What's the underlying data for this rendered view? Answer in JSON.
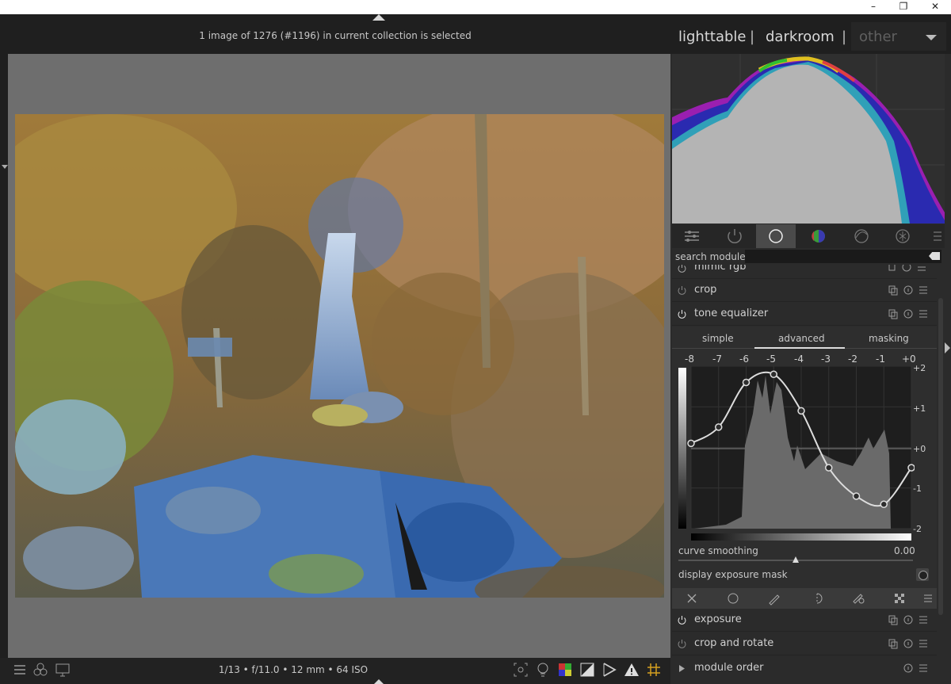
{
  "window": {
    "minimize_glyph": "–",
    "maximize_glyph": "❐",
    "close_glyph": "✕"
  },
  "header": {
    "selection_info": "1 image of 1276 (#1196) in current collection is selected"
  },
  "views": {
    "lighttable": "lighttable",
    "darkroom": "darkroom",
    "sep": "|",
    "other": "other"
  },
  "footer": {
    "image_info": "1/13 • f/11.0 • 12 mm • 64 ISO"
  },
  "search": {
    "label": "search module",
    "value": ""
  },
  "modules": {
    "partial": "mimic rgb",
    "crop": "crop",
    "tone_equalizer": "tone equalizer",
    "exposure": "exposure",
    "crop_rotate": "crop and rotate",
    "module_order": "module order"
  },
  "tone_equalizer": {
    "tabs": [
      "simple",
      "advanced",
      "masking"
    ],
    "active_tab": "advanced",
    "ev_top": [
      "-8",
      "-7",
      "-6",
      "-5",
      "-4",
      "-3",
      "-2",
      "-1",
      "+0"
    ],
    "ev_right": [
      "+2",
      "+1",
      "+0",
      "-1",
      "-2"
    ],
    "curve_nodes_ev": [
      0.1,
      0.5,
      1.6,
      1.8,
      0.9,
      -0.5,
      -1.2,
      -1.4,
      -0.5
    ],
    "curve_smoothing_label": "curve smoothing",
    "curve_smoothing_value": "0.00",
    "display_mask_label": "display exposure mask"
  },
  "colors": {
    "accent": "#dcdcdc",
    "panel": "#2b2b2b",
    "canvas": "#6e6e6e"
  },
  "icons": {
    "tabs": [
      "sliders-icon",
      "power-icon",
      "circle-icon",
      "color-icon",
      "correct-icon",
      "effect-icon",
      "menu-icon"
    ],
    "blend": [
      "close-icon",
      "circle-icon",
      "brush-icon",
      "parametric-icon",
      "drawn-parametric-icon",
      "raster-icon",
      "menu-icon"
    ]
  }
}
